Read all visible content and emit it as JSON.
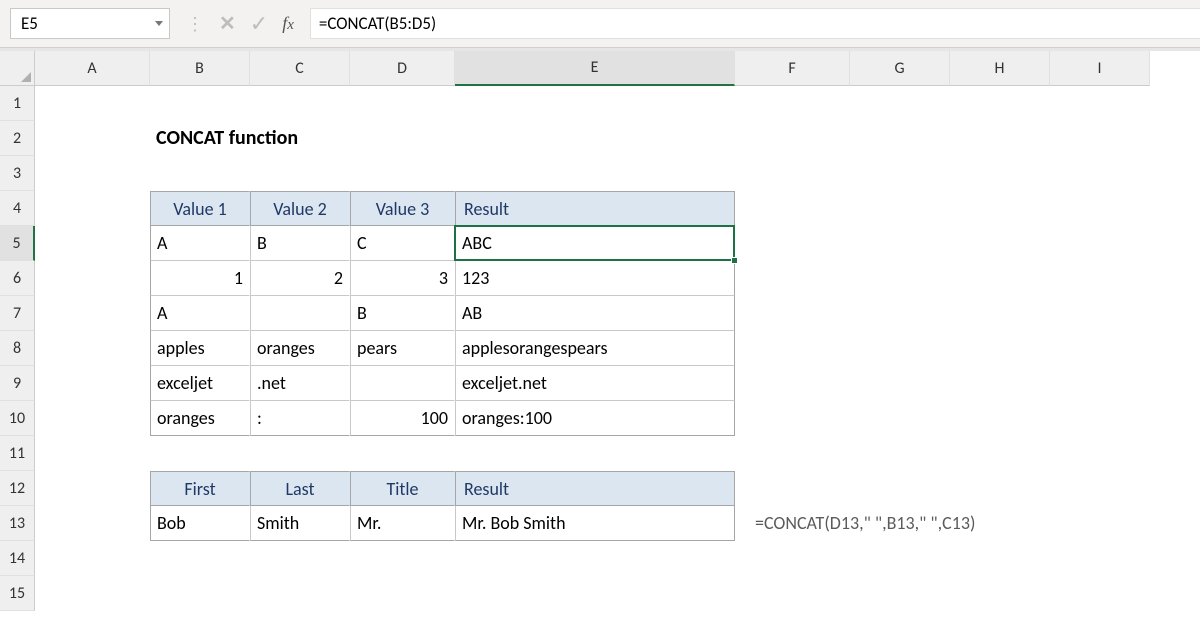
{
  "formula_bar": {
    "cell_ref": "E5",
    "formula": "=CONCAT(B5:D5)"
  },
  "columns": [
    "A",
    "B",
    "C",
    "D",
    "E",
    "F",
    "G",
    "H",
    "I"
  ],
  "rows": [
    "1",
    "2",
    "3",
    "4",
    "5",
    "6",
    "7",
    "8",
    "9",
    "10",
    "11",
    "12",
    "13",
    "14",
    "15"
  ],
  "selected": {
    "col_index": 4,
    "row_index": 4
  },
  "title": "CONCAT function",
  "table1": {
    "headers": [
      "Value 1",
      "Value 2",
      "Value 3",
      "Result"
    ],
    "rows": [
      {
        "v1": "A",
        "v2": "B",
        "v3": "C",
        "res": "ABC",
        "align": [
          "l",
          "l",
          "l",
          "l"
        ]
      },
      {
        "v1": "1",
        "v2": "2",
        "v3": "3",
        "res": "123",
        "align": [
          "r",
          "r",
          "r",
          "l"
        ]
      },
      {
        "v1": "A",
        "v2": "",
        "v3": "B",
        "res": "AB",
        "align": [
          "l",
          "l",
          "l",
          "l"
        ]
      },
      {
        "v1": "apples",
        "v2": "oranges",
        "v3": "pears",
        "res": "applesorangespears",
        "align": [
          "l",
          "l",
          "l",
          "l"
        ]
      },
      {
        "v1": "exceljet",
        "v2": ".net",
        "v3": "",
        "res": "exceljet.net",
        "align": [
          "l",
          "l",
          "l",
          "l"
        ]
      },
      {
        "v1": "oranges",
        "v2": ":",
        "v3": "100",
        "res": "oranges:100",
        "align": [
          "l",
          "l",
          "r",
          "l"
        ]
      }
    ]
  },
  "table2": {
    "headers": [
      "First",
      "Last",
      "Title",
      "Result"
    ],
    "row": {
      "first": "Bob",
      "last": "Smith",
      "title": "Mr.",
      "res": "Mr. Bob Smith"
    }
  },
  "annotation": "=CONCAT(D13,\" \",B13,\" \",C13)",
  "chart_data": {
    "type": "table",
    "tables": [
      {
        "columns": [
          "Value 1",
          "Value 2",
          "Value 3",
          "Result"
        ],
        "rows": [
          [
            "A",
            "B",
            "C",
            "ABC"
          ],
          [
            1,
            2,
            3,
            "123"
          ],
          [
            "A",
            "",
            "B",
            "AB"
          ],
          [
            "apples",
            "oranges",
            "pears",
            "applesorangespears"
          ],
          [
            "exceljet",
            ".net",
            "",
            "exceljet.net"
          ],
          [
            "oranges",
            ":",
            100,
            "oranges:100"
          ]
        ]
      },
      {
        "columns": [
          "First",
          "Last",
          "Title",
          "Result"
        ],
        "rows": [
          [
            "Bob",
            "Smith",
            "Mr.",
            "Mr. Bob Smith"
          ]
        ]
      }
    ]
  }
}
